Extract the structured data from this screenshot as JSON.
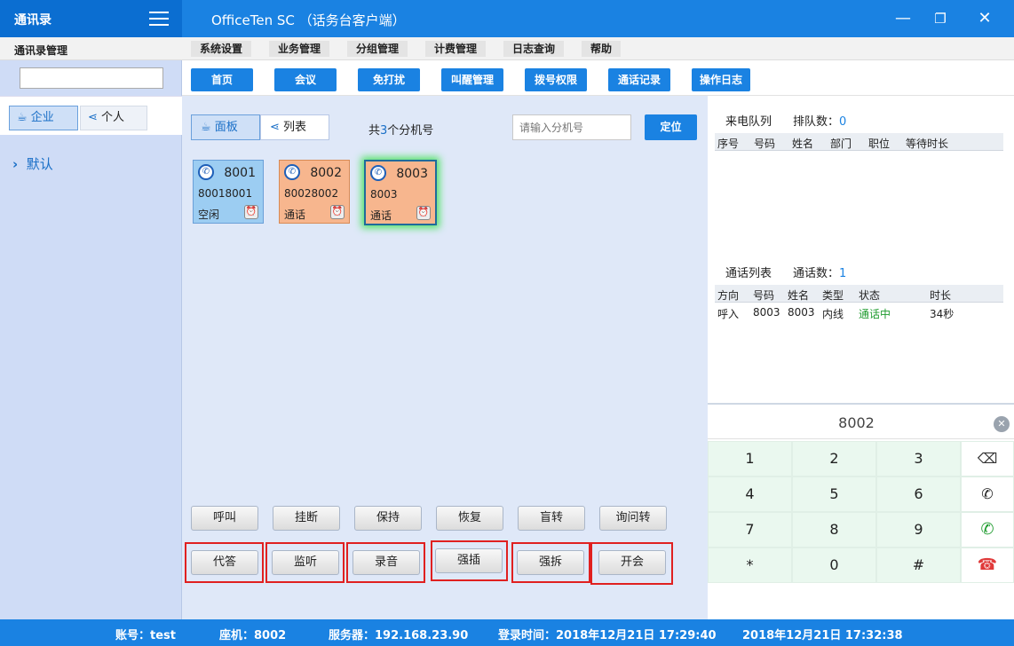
{
  "titlebar": {
    "app_title": "通讯录",
    "window_title": "OfficeTen SC （话务台客户端）"
  },
  "menubar": {
    "section_label": "通讯录管理",
    "items": [
      "系统设置",
      "业务管理",
      "分组管理",
      "计费管理",
      "日志查询",
      "帮助"
    ]
  },
  "left": {
    "search_value": "",
    "tab_enterprise": "企业",
    "tab_personal": "个人",
    "nav_default": "默认"
  },
  "toolbar": {
    "buttons": [
      "首页",
      "会议",
      "免打扰",
      "叫醒管理",
      "拨号权限",
      "通话记录",
      "操作日志"
    ]
  },
  "center": {
    "view_panel": "面板",
    "view_list": "列表",
    "count_prefix": "共",
    "count_value": "3",
    "count_suffix": "个分机号",
    "ext_placeholder": "请输入分机号",
    "locate_button": "定位",
    "cards": [
      {
        "ext": "8001",
        "number": "80018001",
        "status": "空闲"
      },
      {
        "ext": "8002",
        "number": "80028002",
        "status": "通话"
      },
      {
        "ext": "8003",
        "number": "8003",
        "status": "通话"
      }
    ],
    "actions_row1": [
      "呼叫",
      "挂断",
      "保持",
      "恢复",
      "盲转",
      "询问转"
    ],
    "actions_row2": [
      "代答",
      "监听",
      "录音",
      "强插",
      "强拆",
      "开会"
    ]
  },
  "queue": {
    "title": "来电队列",
    "count_label": "排队数：",
    "count": "0",
    "columns": [
      "序号",
      "号码",
      "姓名",
      "部门",
      "职位",
      "等待时长"
    ]
  },
  "calls": {
    "title": "通话列表",
    "count_label": "通话数：",
    "count": "1",
    "columns": [
      "方向",
      "号码",
      "姓名",
      "类型",
      "状态",
      "时长"
    ],
    "rows": [
      {
        "direction": "呼入",
        "number": "8003",
        "name": "8003",
        "type": "内线",
        "status": "通话中",
        "duration": "34秒"
      }
    ]
  },
  "dialpad": {
    "display": "8002",
    "keys": [
      "1",
      "2",
      "3",
      "4",
      "5",
      "6",
      "7",
      "8",
      "9",
      "*",
      "0",
      "#"
    ]
  },
  "statusbar": {
    "account": "账号：test",
    "seat": "座机：8002",
    "server": "服务器：192.168.23.90",
    "login_time": "登录时间：2018年12月21日 17:29:40",
    "now": "2018年12月21日 17:32:38"
  },
  "colors": {
    "primary": "#1a82e2",
    "card_idle": "#9ccdf2",
    "card_busy": "#f7b68e",
    "status_green": "#1e9b2e",
    "hangup_red": "#e03a3a"
  }
}
